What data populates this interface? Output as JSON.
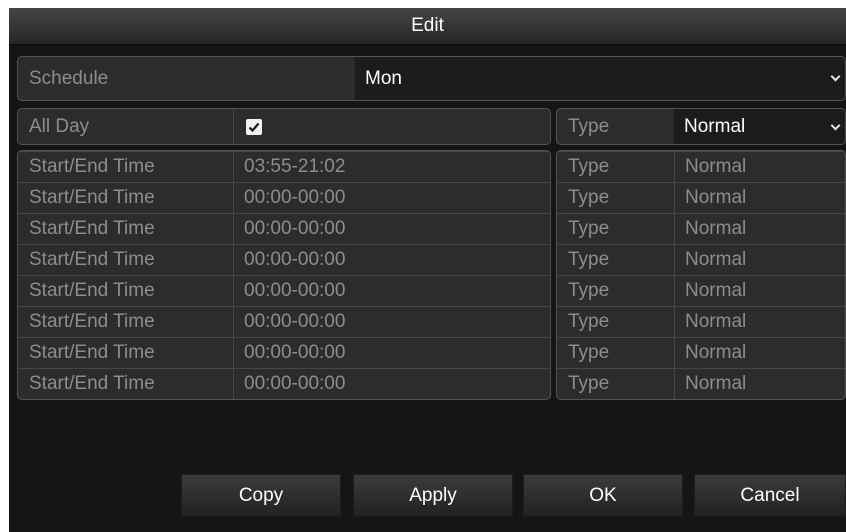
{
  "dialog": {
    "title": "Edit"
  },
  "schedule": {
    "label": "Schedule",
    "value": "Mon"
  },
  "all_day": {
    "label": "All Day",
    "checked": true
  },
  "type_header": {
    "label": "Type",
    "value": "Normal"
  },
  "periods": [
    {
      "label": "Start/End Time",
      "time": "03:55-21:02",
      "type_label": "Type",
      "type_value": "Normal"
    },
    {
      "label": "Start/End Time",
      "time": "00:00-00:00",
      "type_label": "Type",
      "type_value": "Normal"
    },
    {
      "label": "Start/End Time",
      "time": "00:00-00:00",
      "type_label": "Type",
      "type_value": "Normal"
    },
    {
      "label": "Start/End Time",
      "time": "00:00-00:00",
      "type_label": "Type",
      "type_value": "Normal"
    },
    {
      "label": "Start/End Time",
      "time": "00:00-00:00",
      "type_label": "Type",
      "type_value": "Normal"
    },
    {
      "label": "Start/End Time",
      "time": "00:00-00:00",
      "type_label": "Type",
      "type_value": "Normal"
    },
    {
      "label": "Start/End Time",
      "time": "00:00-00:00",
      "type_label": "Type",
      "type_value": "Normal"
    },
    {
      "label": "Start/End Time",
      "time": "00:00-00:00",
      "type_label": "Type",
      "type_value": "Normal"
    }
  ],
  "buttons": {
    "copy": "Copy",
    "apply": "Apply",
    "ok": "OK",
    "cancel": "Cancel"
  },
  "icons": {
    "dropdown": "chevron-down-icon",
    "check": "checkmark-icon"
  }
}
